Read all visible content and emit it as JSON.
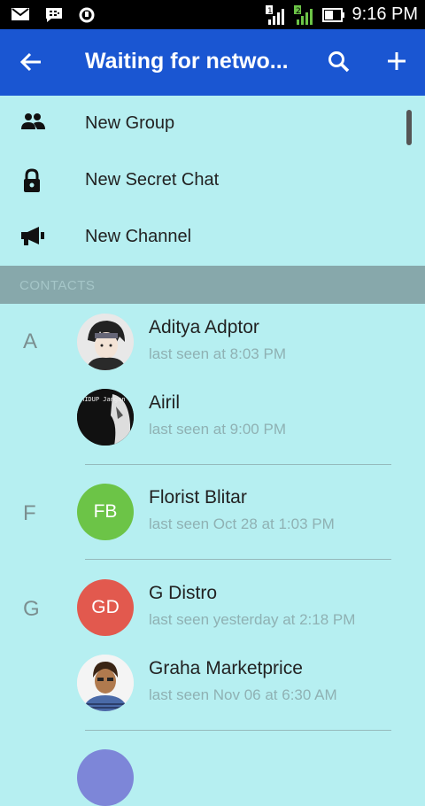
{
  "status_bar": {
    "time": "9:16 PM",
    "sim1": "1",
    "sim2": "2"
  },
  "app_bar": {
    "title": "Waiting for netwo..."
  },
  "menu": {
    "items": [
      {
        "label": "New Group",
        "icon": "group-icon"
      },
      {
        "label": "New Secret Chat",
        "icon": "lock-icon"
      },
      {
        "label": "New Channel",
        "icon": "megaphone-icon"
      }
    ]
  },
  "contacts_header": "CONTACTS",
  "letters": [
    "A",
    "F",
    "G"
  ],
  "contacts": [
    {
      "name": "Aditya Adptor",
      "last_seen": "last seen at 8:03 PM",
      "avatar": "photo"
    },
    {
      "name": "Airil",
      "last_seen": "last seen at 9:00 PM",
      "avatar": "photo",
      "avatar_text": "HIDUP Jangan Banyak GAYA MENDING Banyak"
    },
    {
      "name": "Florist Blitar",
      "last_seen": "last seen Oct 28 at 1:03 PM",
      "initials": "FB",
      "color": "#6cc447"
    },
    {
      "name": "G Distro",
      "last_seen": "last seen yesterday at 2:18 PM",
      "initials": "GD",
      "color": "#e2594e"
    },
    {
      "name": "Graha Marketprice",
      "last_seen": "last seen Nov 06 at 6:30 AM",
      "avatar": "photo"
    }
  ],
  "colors": {
    "app_bar": "#1a56d2",
    "background": "#b6eff1",
    "section_header": "#87a8ab",
    "next_avatar": "#7d86d8"
  }
}
